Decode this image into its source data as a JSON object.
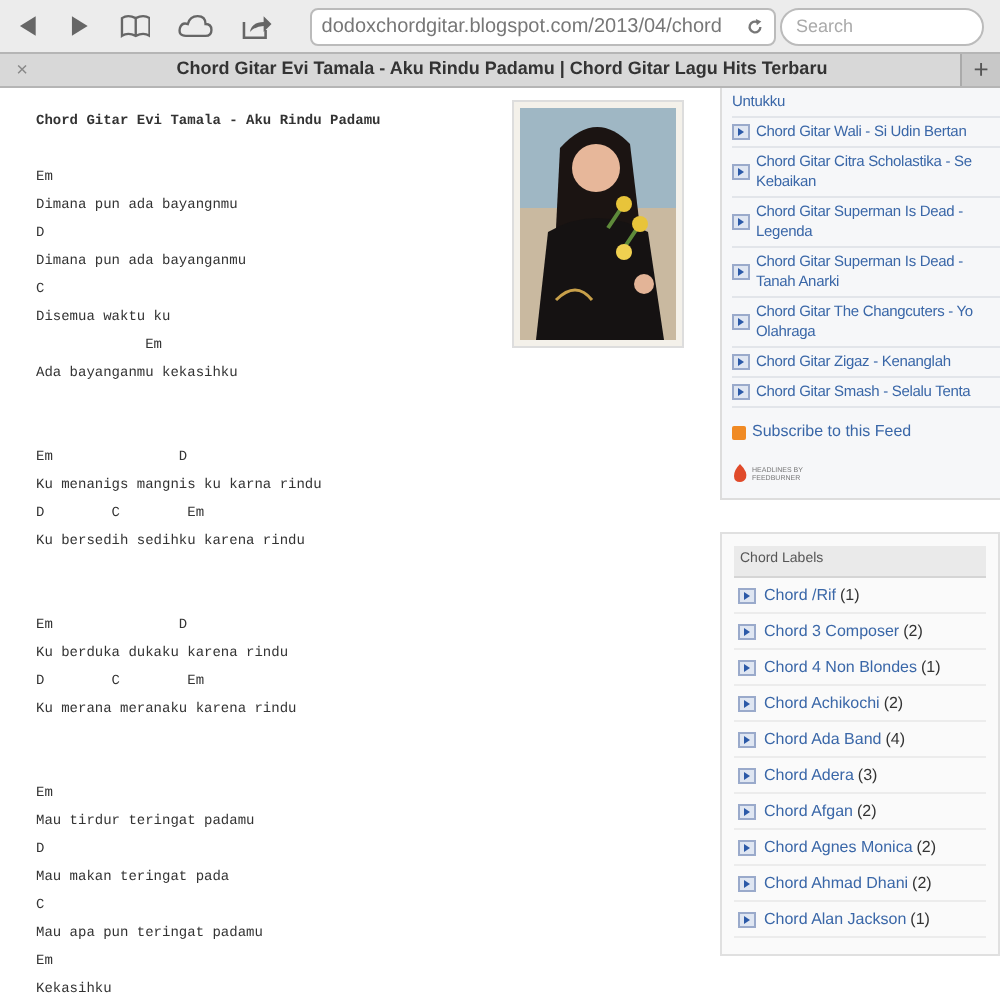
{
  "browser": {
    "url": "dodoxchordgitar.blogspot.com/2013/04/chord",
    "search": {
      "placeholder": "Search"
    },
    "tab": {
      "close": "×",
      "title": "Chord Gitar Evi Tamala - Aku Rindu Padamu | Chord Gitar Lagu Hits Terbaru"
    },
    "new_tab": "+"
  },
  "post": {
    "title": "Chord Gitar Evi Tamala - Aku Rindu Padamu",
    "verses": [
      [
        "Em",
        "Dimana pun ada bayangnmu",
        "D",
        "Dimana pun ada bayanganmu",
        "C",
        "Disemua waktu ku",
        "             Em",
        "Ada bayanganmu kekasihku"
      ],
      [
        "Em               D",
        "Ku menanigs mangnis ku karna rindu",
        "D        C        Em",
        "Ku bersedih sedihku karena rindu"
      ],
      [
        "Em               D",
        "Ku berduka dukaku karena rindu",
        "D        C        Em",
        "Ku merana meranaku karena rindu"
      ],
      [
        "Em",
        "Mau tirdur teringat padamu",
        "D",
        "Mau makan teringat pada",
        "C",
        "Mau apa pun teringat padamu",
        "Em",
        "Kekasihku"
      ]
    ]
  },
  "feed": {
    "items": [
      "Untukku",
      "Chord Gitar Wali - Si Udin Bertan",
      "Chord Gitar Citra Scholastika - Se\nKebaikan",
      "Chord Gitar Superman Is Dead -\nLegenda",
      "Chord Gitar Superman Is Dead -\nTanah Anarki",
      "Chord Gitar The Changcuters - Yo\nOlahraga",
      "Chord Gitar Zigaz - Kenanglah",
      "Chord Gitar Smash - Selalu Tenta"
    ],
    "subscribe": "Subscribe to this Feed",
    "badge": "HEADLINES BY FEEDBURNER"
  },
  "labels": {
    "title": "Chord Labels",
    "items": [
      {
        "name": "Chord /Rif",
        "count": "(1)"
      },
      {
        "name": "Chord 3 Composer",
        "count": "(2)"
      },
      {
        "name": "Chord 4 Non Blondes",
        "count": "(1)"
      },
      {
        "name": "Chord Achikochi",
        "count": "(2)"
      },
      {
        "name": "Chord Ada Band",
        "count": "(4)"
      },
      {
        "name": "Chord Adera",
        "count": "(3)"
      },
      {
        "name": "Chord Afgan",
        "count": "(2)"
      },
      {
        "name": "Chord Agnes Monica",
        "count": "(2)"
      },
      {
        "name": "Chord Ahmad Dhani",
        "count": "(2)"
      },
      {
        "name": "Chord Alan Jackson",
        "count": "(1)"
      }
    ]
  }
}
